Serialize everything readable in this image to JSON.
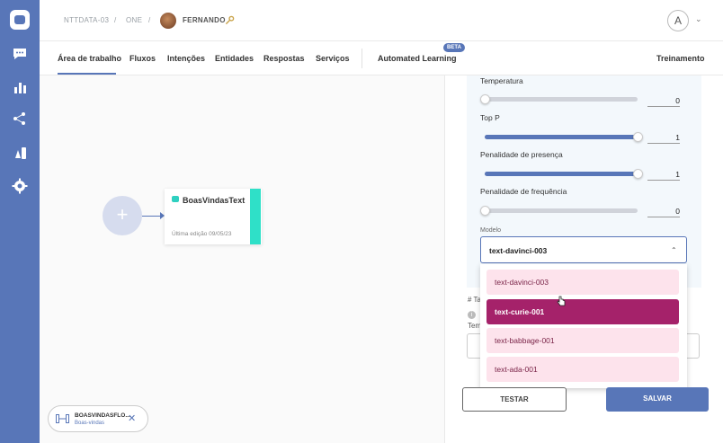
{
  "breadcrumb": {
    "workspace": "NTTDATA-03",
    "sep1": "/",
    "bot": "ONE",
    "sep2": "/",
    "user": "FERNANDO"
  },
  "user_avatar_letter": "A",
  "tabs": [
    {
      "label": "Área de trabalho",
      "active": true
    },
    {
      "label": "Fluxos"
    },
    {
      "label": "Intenções"
    },
    {
      "label": "Entidades"
    },
    {
      "label": "Respostas"
    },
    {
      "label": "Serviços"
    },
    {
      "label": "Automated Learning",
      "badge": "BETA"
    },
    {
      "label": "Treinamento"
    }
  ],
  "flow_node": {
    "title": "BoasVindasText",
    "subtitle": "Última edição 09/05/23"
  },
  "flow_chip": {
    "title": "BOASVINDASFLO...",
    "subtitle": "Boas-vindas"
  },
  "params": [
    {
      "label": "Temperatura",
      "value": "0",
      "fraction": 0
    },
    {
      "label": "Top P",
      "value": "1",
      "fraction": 1
    },
    {
      "label": "Penalidade de presença",
      "value": "1",
      "fraction": 1
    },
    {
      "label": "Penalidade de frequência",
      "value": "0",
      "fraction": 0
    }
  ],
  "model": {
    "label": "Modelo",
    "selected": "text-davinci-003",
    "options": [
      "text-davinci-003",
      "text-curie-001",
      "text-babbage-001",
      "text-ada-001"
    ],
    "highlighted": "text-curie-001"
  },
  "behind_text": {
    "hash": "# Ta",
    "info": "i",
    "tem": "Tem"
  },
  "buttons": {
    "test": "TESTAR",
    "save": "SALVAR"
  },
  "colors": {
    "sidebar": "#5876b8",
    "accent": "#5876b8",
    "highlight": "#a5226a",
    "node_bar": "#2fe0c8"
  }
}
